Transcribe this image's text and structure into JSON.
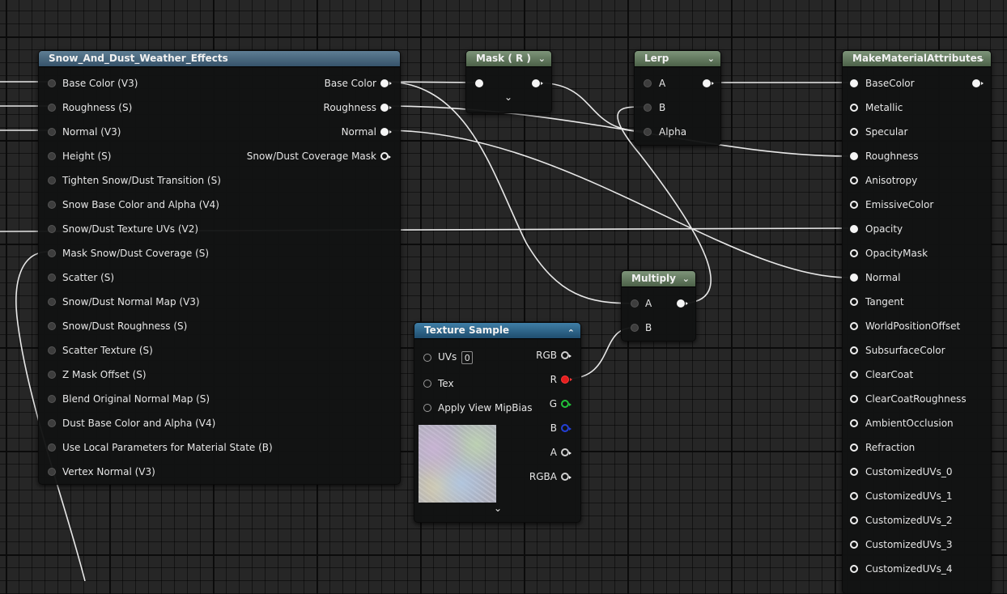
{
  "nodes": {
    "snow": {
      "title": "Snow_And_Dust_Weather_Effects",
      "inputs": [
        "Base Color (V3)",
        "Roughness (S)",
        "Normal (V3)",
        "Height (S)",
        "Tighten Snow/Dust Transition (S)",
        "Snow Base Color and Alpha (V4)",
        "Snow/Dust Texture UVs (V2)",
        "Mask Snow/Dust Coverage (S)",
        "Scatter (S)",
        "Snow/Dust Normal Map (V3)",
        "Snow/Dust Roughness (S)",
        "Scatter Texture (S)",
        "Z Mask Offset (S)",
        "Blend Original Normal Map (S)",
        "Dust Base Color and Alpha (V4)",
        "Use Local Parameters for Material State (B)",
        "Vertex Normal (V3)"
      ],
      "outputs": [
        "Base Color",
        "Roughness",
        "Normal",
        "Snow/Dust Coverage Mask"
      ]
    },
    "mask": {
      "title": "Mask ( R )"
    },
    "lerp": {
      "title": "Lerp",
      "inputs": [
        "A",
        "B",
        "Alpha"
      ]
    },
    "multiply": {
      "title": "Multiply",
      "inputs": [
        "A",
        "B"
      ]
    },
    "texture": {
      "title": "Texture Sample",
      "inputs": [
        "UVs",
        "Tex",
        "Apply View MipBias"
      ],
      "uv_value": "0",
      "outputs": [
        "RGB",
        "R",
        "G",
        "B",
        "A",
        "RGBA"
      ]
    },
    "mma": {
      "title": "MakeMaterialAttributes",
      "inputs": [
        "BaseColor",
        "Metallic",
        "Specular",
        "Roughness",
        "Anisotropy",
        "EmissiveColor",
        "Opacity",
        "OpacityMask",
        "Normal",
        "Tangent",
        "WorldPositionOffset",
        "SubsurfaceColor",
        "ClearCoat",
        "ClearCoatRoughness",
        "AmbientOcclusion",
        "Refraction",
        "CustomizedUVs_0",
        "CustomizedUVs_1",
        "CustomizedUVs_2",
        "CustomizedUVs_3",
        "CustomizedUVs_4"
      ]
    }
  },
  "icons": {
    "chevron_down": "⌄",
    "chevron_up": "⌃",
    "header_collapse": "⌄"
  },
  "colors": {
    "channel_r": "#e51e1e",
    "channel_g": "#22c53a",
    "channel_b": "#2340d8",
    "wire": "#e8e8e8"
  }
}
